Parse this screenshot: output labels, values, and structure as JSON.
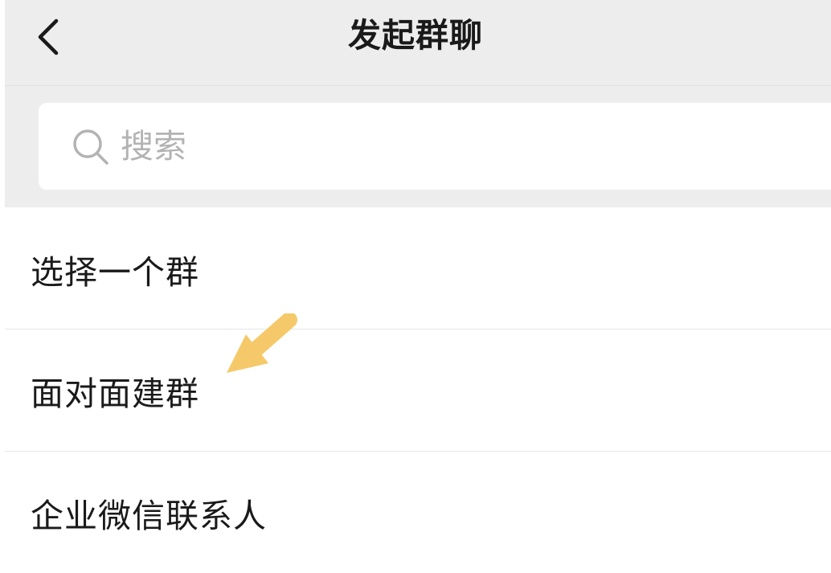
{
  "header": {
    "title": "发起群聊",
    "back_icon": "chevron-left-icon",
    "background": "#ededed"
  },
  "search": {
    "placeholder": "搜索",
    "icon": "search-icon"
  },
  "list": {
    "items": [
      {
        "label": "选择一个群"
      },
      {
        "label": "面对面建群"
      },
      {
        "label": "企业微信联系人"
      }
    ]
  },
  "annotation": {
    "icon": "pointer-arrow-icon",
    "color": "#f5c96a"
  }
}
